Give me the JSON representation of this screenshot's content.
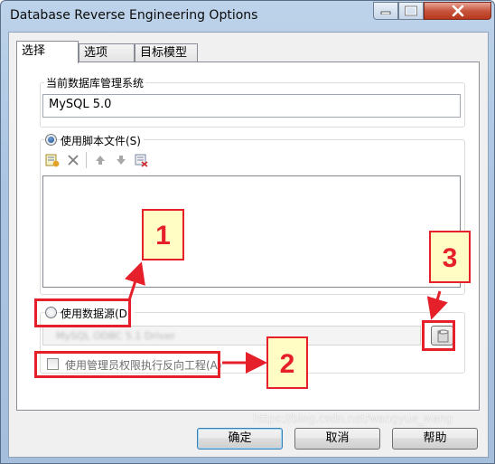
{
  "window": {
    "title": "Database Reverse Engineering Options"
  },
  "tabs": [
    {
      "label": "选择",
      "active": true
    },
    {
      "label": "选项",
      "active": false
    },
    {
      "label": "目标模型",
      "active": false
    }
  ],
  "dbms_group": {
    "label": "当前数据库管理系统",
    "value": "MySQL 5.0"
  },
  "script_option": {
    "label": "使用脚本文件(S)",
    "checked": true,
    "toolbar": [
      "add-file-icon",
      "delete-icon",
      "move-up-icon",
      "move-down-icon",
      "clear-icon"
    ]
  },
  "datasource_option": {
    "label": "使用数据源(D)",
    "checked": false,
    "blurred_value": "MySQL ODBC 5.1 Driver"
  },
  "admin_option": {
    "label": "使用管理员权限执行反向工程(A)",
    "checked": false
  },
  "buttons": {
    "ok": "确定",
    "cancel": "取消",
    "help": "帮助"
  },
  "watermark": "https://blog.csdn.net/wangyue_wang",
  "annotations": [
    {
      "label": "1"
    },
    {
      "label": "2"
    },
    {
      "label": "3"
    }
  ],
  "colors": {
    "annotation_red": "#e5202b",
    "annotation_fill": "#fffcc4",
    "title_bar": "#aac4e2",
    "close_button": "#c8553e"
  }
}
